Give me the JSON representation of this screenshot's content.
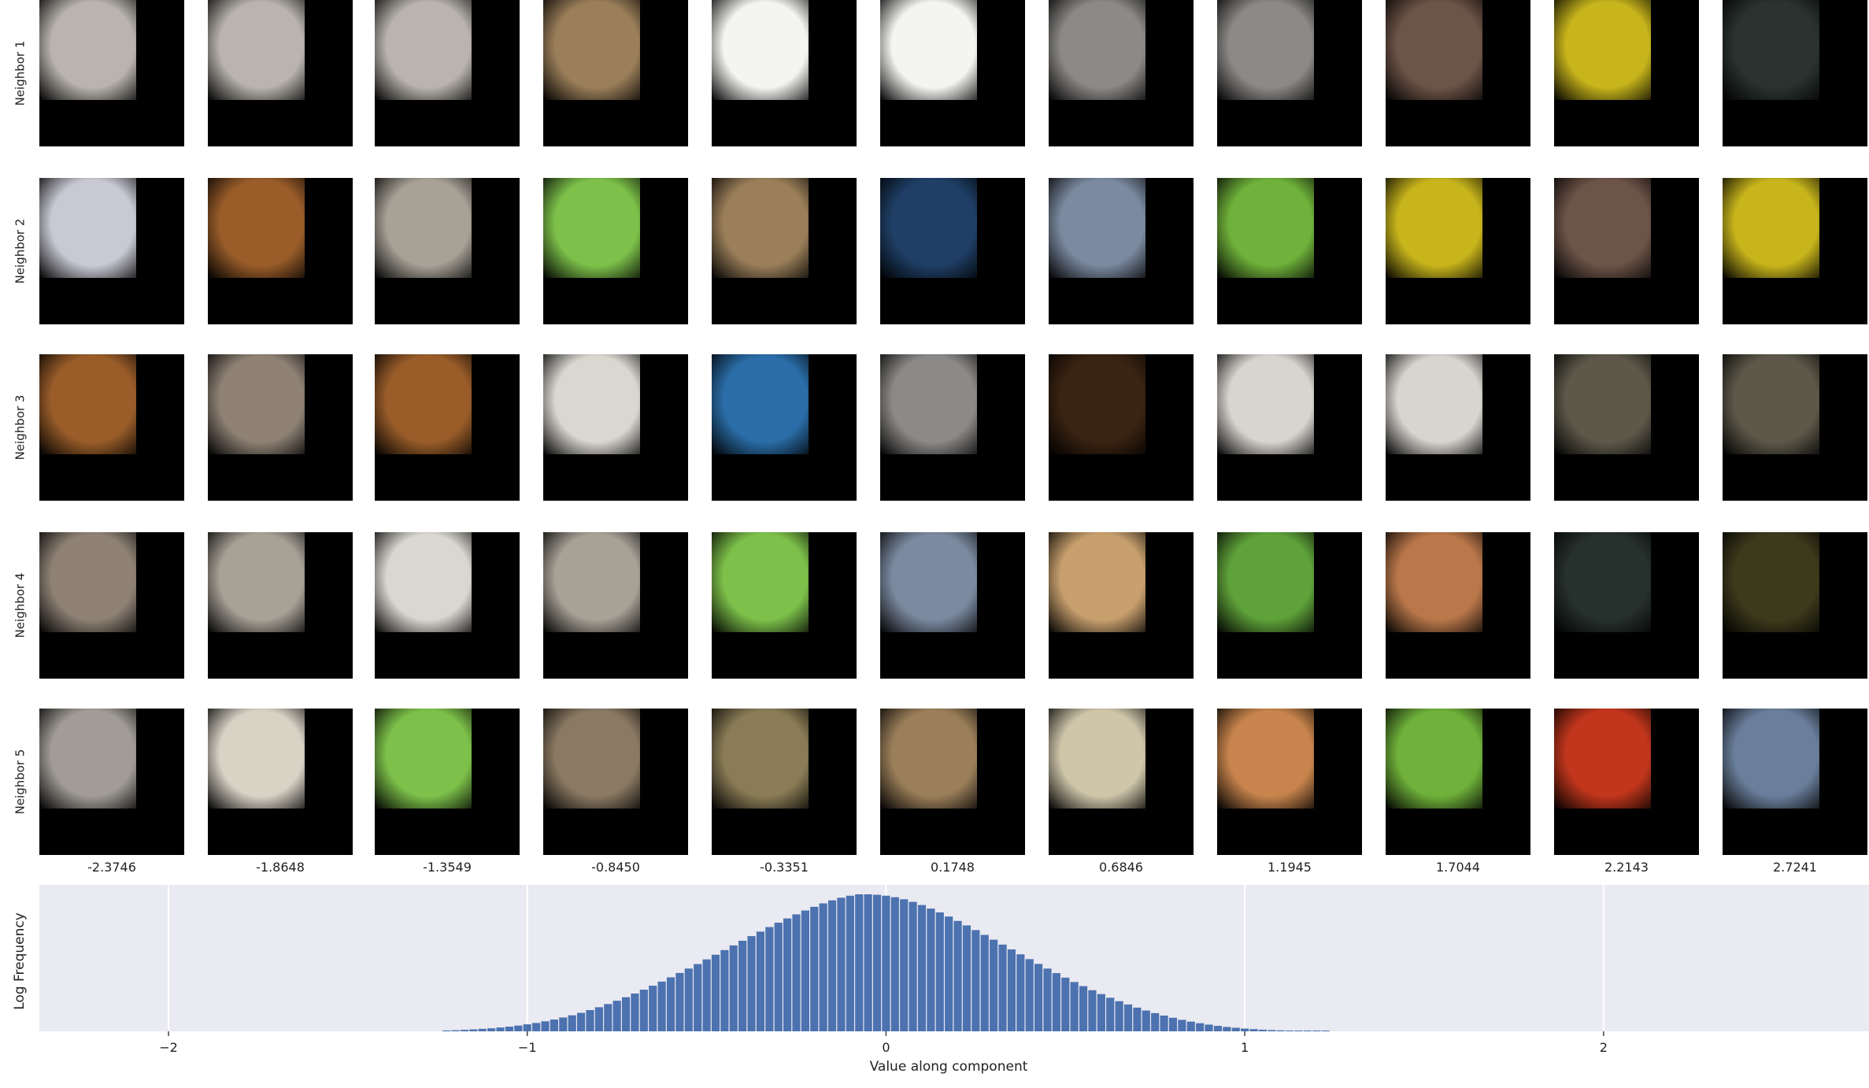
{
  "row_labels": [
    "Neighbor 1",
    "Neighbor 2",
    "Neighbor 3",
    "Neighbor 4",
    "Neighbor 5"
  ],
  "column_values": [
    "-2.3746",
    "-1.8648",
    "-1.3549",
    "-0.8450",
    "-0.3351",
    "0.1748",
    "0.6846",
    "1.1945",
    "1.7044",
    "2.2143",
    "2.7241"
  ],
  "cell_colors": [
    [
      "#b9b4ad",
      "#b9b4ad",
      "#b9b4ad",
      "#9b7f5a",
      "#f4f4f2",
      "#f4f4f2",
      "#8c8a88",
      "#8c8a88",
      "#6d5448",
      "#c8b51c",
      "#2a3330"
    ],
    [
      "#c9c9d4",
      "#9a5d2a",
      "#a7a196",
      "#7dc14a",
      "#9b7f5a",
      "#1f3f66",
      "#7b8aa0",
      "#6fb13a",
      "#c8b51c",
      "#6d5448",
      "#c8b51c"
    ],
    [
      "#9a5d2a",
      "#8f8275",
      "#9a5d2a",
      "#dad7d0",
      "#2a6da8",
      "#8c8a88",
      "#3a2312",
      "#d8d4cf",
      "#d8d4cf",
      "#5d5849",
      "#5d5849"
    ],
    [
      "#8f8275",
      "#a7a196",
      "#dad7d0",
      "#a7a196",
      "#7dc14a",
      "#7b8aa0",
      "#c8a06e",
      "#5fa23a",
      "#b9774a",
      "#26302c",
      "#3d3a1c"
    ],
    [
      "#a19c96",
      "#d9d3c6",
      "#7dc14a",
      "#8b7a63",
      "#8a7c56",
      "#9b7f5a",
      "#cfc6aa",
      "#c7844c",
      "#6fb13a",
      "#c1361c",
      "#6a7f9b"
    ]
  ],
  "chart_data": {
    "type": "bar",
    "title": "",
    "xlabel": "Value along component",
    "ylabel": "Log Frequency",
    "xlim": [
      -2.36,
      2.74
    ],
    "xticks": [
      -2,
      -1,
      0,
      1,
      2
    ],
    "xtick_labels": [
      "−2",
      "−1",
      "0",
      "1",
      "2"
    ],
    "grid": true,
    "bin_width": 0.025,
    "x": [
      -1.225,
      -1.2,
      -1.175,
      -1.15,
      -1.125,
      -1.1,
      -1.075,
      -1.05,
      -1.025,
      -1.0,
      -0.975,
      -0.95,
      -0.925,
      -0.9,
      -0.875,
      -0.85,
      -0.825,
      -0.8,
      -0.775,
      -0.75,
      -0.725,
      -0.7,
      -0.675,
      -0.65,
      -0.625,
      -0.6,
      -0.575,
      -0.55,
      -0.525,
      -0.5,
      -0.475,
      -0.45,
      -0.425,
      -0.4,
      -0.375,
      -0.35,
      -0.325,
      -0.3,
      -0.275,
      -0.25,
      -0.225,
      -0.2,
      -0.175,
      -0.15,
      -0.125,
      -0.1,
      -0.075,
      -0.05,
      -0.025,
      0.0,
      0.025,
      0.05,
      0.075,
      0.1,
      0.125,
      0.15,
      0.175,
      0.2,
      0.225,
      0.25,
      0.275,
      0.3,
      0.325,
      0.35,
      0.375,
      0.4,
      0.425,
      0.45,
      0.475,
      0.5,
      0.525,
      0.55,
      0.575,
      0.6,
      0.625,
      0.65,
      0.675,
      0.7,
      0.725,
      0.75,
      0.775,
      0.8,
      0.825,
      0.85,
      0.875,
      0.9,
      0.925,
      0.95,
      0.975,
      1.0,
      1.025,
      1.05,
      1.075,
      1.1,
      1.125,
      1.15,
      1.175,
      1.2,
      1.225
    ],
    "values": [
      0.006,
      0.008,
      0.011,
      0.014,
      0.018,
      0.022,
      0.028,
      0.034,
      0.042,
      0.051,
      0.061,
      0.073,
      0.086,
      0.101,
      0.117,
      0.135,
      0.155,
      0.176,
      0.199,
      0.223,
      0.249,
      0.276,
      0.304,
      0.333,
      0.363,
      0.394,
      0.426,
      0.458,
      0.491,
      0.525,
      0.559,
      0.593,
      0.627,
      0.661,
      0.695,
      0.728,
      0.761,
      0.793,
      0.824,
      0.854,
      0.882,
      0.909,
      0.934,
      0.956,
      0.975,
      0.99,
      1.0,
      1.0,
      0.997,
      0.99,
      0.979,
      0.964,
      0.945,
      0.922,
      0.896,
      0.868,
      0.838,
      0.806,
      0.773,
      0.739,
      0.704,
      0.669,
      0.633,
      0.598,
      0.562,
      0.527,
      0.492,
      0.458,
      0.425,
      0.392,
      0.36,
      0.33,
      0.3,
      0.272,
      0.245,
      0.22,
      0.196,
      0.173,
      0.152,
      0.133,
      0.115,
      0.099,
      0.084,
      0.071,
      0.059,
      0.049,
      0.04,
      0.032,
      0.026,
      0.02,
      0.016,
      0.012,
      0.009,
      0.007,
      0.005,
      0.004,
      0.003,
      0.002,
      0.001
    ],
    "bar_color": "#4c72b0",
    "background": "#eaeaf2"
  }
}
